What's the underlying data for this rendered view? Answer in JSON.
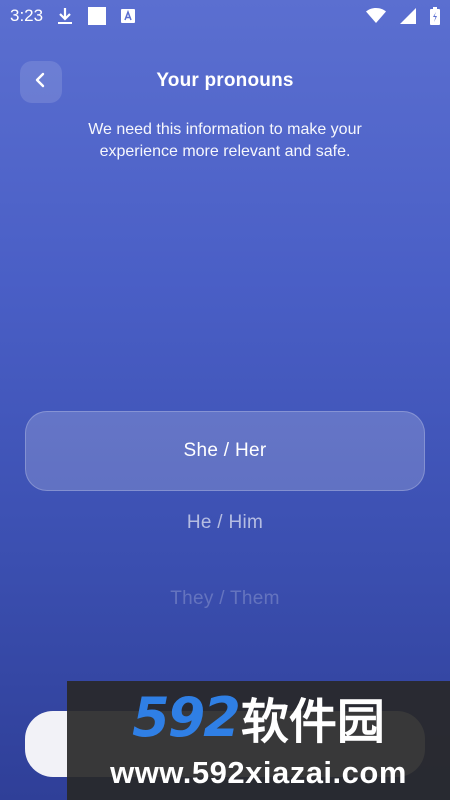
{
  "status_bar": {
    "time": "3:23",
    "left_icons": [
      "download-icon",
      "square-icon",
      "a-box-icon"
    ],
    "right_icons": [
      "wifi-icon",
      "signal-icon",
      "battery-icon"
    ]
  },
  "header": {
    "back_icon": "chevron-left-icon",
    "title": "Your pronouns",
    "subtitle": "We need this information to make your experience more relevant and safe."
  },
  "options": [
    {
      "label": "She / Her",
      "selected": true
    },
    {
      "label": "He / Him",
      "selected": false
    },
    {
      "label": "They / Them",
      "selected": false
    }
  ],
  "watermark": {
    "brand_number": "592",
    "brand_text": "软件园",
    "url": "www.592xiazai.com"
  },
  "colors": {
    "background_top": "#5b6fd0",
    "background_bottom": "#2f3f98",
    "watermark_blue": "#2f7fe5"
  }
}
